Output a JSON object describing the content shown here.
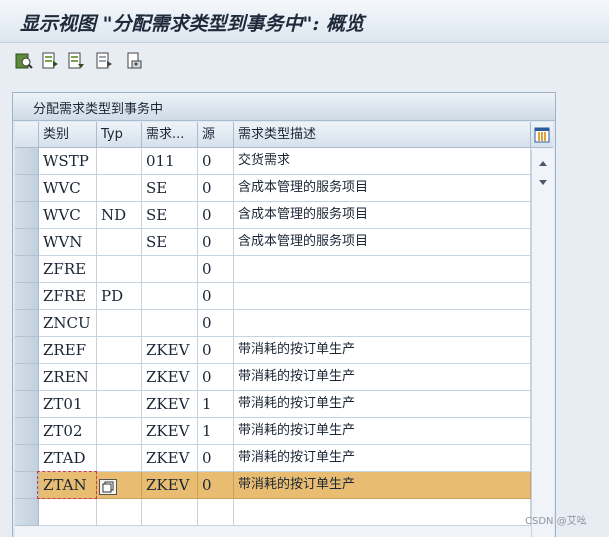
{
  "window": {
    "title": "显示视图 \"分配需求类型到事务中\": 概览"
  },
  "toolbar": {
    "buttons": [
      {
        "name": "display-icon"
      },
      {
        "name": "export-icon"
      },
      {
        "name": "select-all-icon"
      },
      {
        "name": "deselect-icon"
      },
      {
        "name": "print-icon"
      }
    ]
  },
  "panel": {
    "title": "分配需求类型到事务中"
  },
  "table": {
    "columns": [
      "类别",
      "Typ",
      "需求...",
      "源",
      "需求类型描述"
    ],
    "rows": [
      [
        "WSTP",
        "",
        "011",
        "0",
        "交货需求"
      ],
      [
        "WVC",
        "",
        "SE",
        "0",
        "含成本管理的服务项目"
      ],
      [
        "WVC",
        "ND",
        "SE",
        "0",
        "含成本管理的服务项目"
      ],
      [
        "WVN",
        "",
        "SE",
        "0",
        "含成本管理的服务项目"
      ],
      [
        "ZFRE",
        "",
        "",
        "0",
        ""
      ],
      [
        "ZFRE",
        "PD",
        "",
        "0",
        ""
      ],
      [
        "ZNCU",
        "",
        "",
        "0",
        ""
      ],
      [
        "ZREF",
        "",
        "ZKEV",
        "0",
        "带消耗的按订单生产"
      ],
      [
        "ZREN",
        "",
        "ZKEV",
        "0",
        "带消耗的按订单生产"
      ],
      [
        "ZT01",
        "",
        "ZKEV",
        "1",
        "带消耗的按订单生产"
      ],
      [
        "ZT02",
        "",
        "ZKEV",
        "1",
        "带消耗的按订单生产"
      ],
      [
        "ZTAD",
        "",
        "ZKEV",
        "0",
        "带消耗的按订单生产"
      ],
      [
        "ZTAN",
        "",
        "ZKEV",
        "0",
        "带消耗的按订单生产"
      ]
    ],
    "selected_row": 12,
    "highlight_color": "#e8bd72"
  },
  "watermark": "CSDN @艾吆"
}
